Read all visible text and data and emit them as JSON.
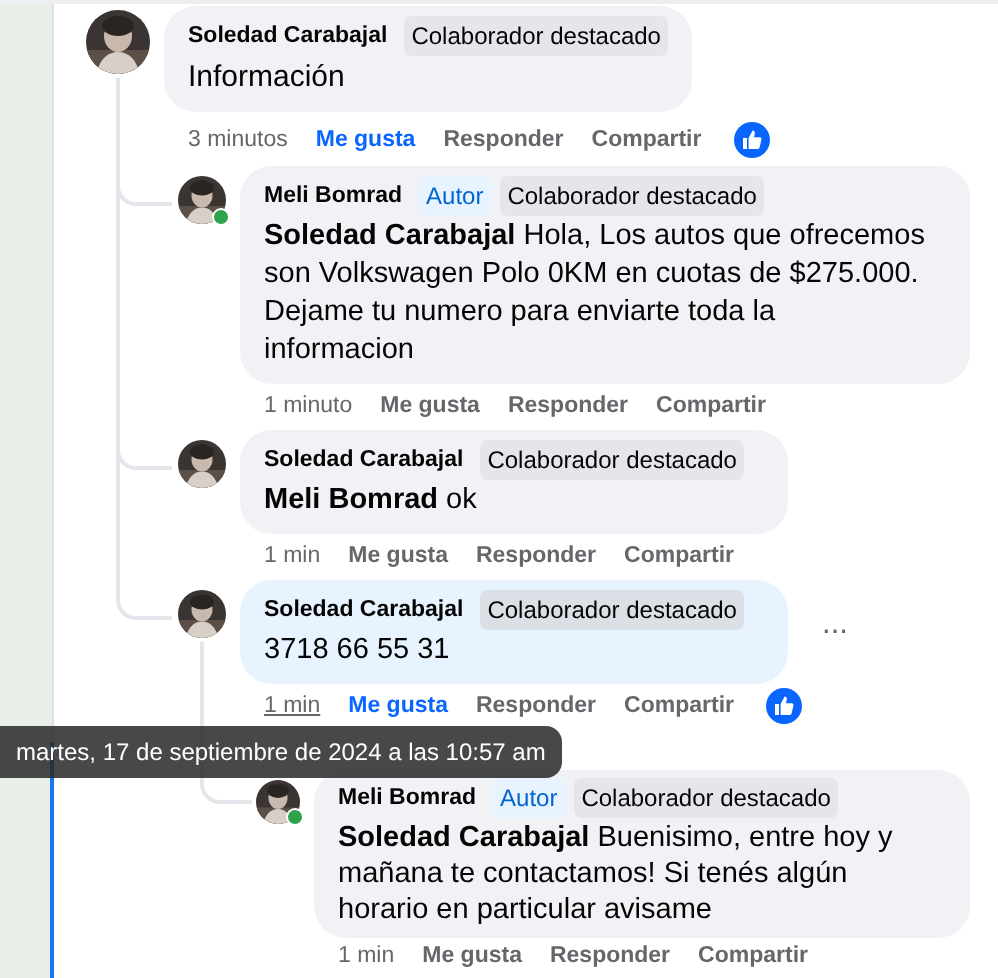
{
  "comments": [
    {
      "author": "Soledad Carabajal",
      "badges": [
        {
          "label": "Colaborador destacado",
          "kind": "contributor"
        }
      ],
      "text": "Información",
      "time": "3 minutos",
      "like_label": "Me gusta",
      "liked": true,
      "reply_label": "Responder",
      "share_label": "Compartir",
      "reaction": true,
      "children": [
        {
          "author": "Meli Bomrad",
          "badges": [
            {
              "label": "Autor",
              "kind": "author"
            },
            {
              "label": "Colaborador destacado",
              "kind": "contributor"
            }
          ],
          "text": "**Soledad Carabajal** Hola, Los autos que ofrecemos son Volkswagen Polo 0KM en cuotas de $275.000. Dejame tu numero para enviarte toda la informacion",
          "time": "1 minuto",
          "like_label": "Me gusta",
          "liked": false,
          "reply_label": "Responder",
          "share_label": "Compartir",
          "online": true
        },
        {
          "author": "Soledad Carabajal",
          "badges": [
            {
              "label": "Colaborador destacado",
              "kind": "contributor"
            }
          ],
          "text": "**Meli Bomrad** ok",
          "time": "1 min",
          "like_label": "Me gusta",
          "liked": false,
          "reply_label": "Responder",
          "share_label": "Compartir"
        },
        {
          "author": "Soledad Carabajal",
          "badges": [
            {
              "label": "Colaborador destacado",
              "kind": "contributor"
            }
          ],
          "text": "3718 66 55 31",
          "time": "1 min",
          "time_hovered": true,
          "like_label": "Me gusta",
          "liked": true,
          "reply_label": "Responder",
          "share_label": "Compartir",
          "reaction": true,
          "highlighted": true,
          "more": "···",
          "tooltip": "martes, 17 de septiembre de 2024 a las 10:57 am",
          "children": [
            {
              "author": "Meli Bomrad",
              "badges": [
                {
                  "label": "Autor",
                  "kind": "author"
                },
                {
                  "label": "Colaborador destacado",
                  "kind": "contributor"
                }
              ],
              "text": "**Soledad Carabajal** Buenisimo, entre hoy y mañana te contactamos! Si tenés algún horario en particular avisame",
              "time": "1 min",
              "like_label": "Me gusta",
              "liked": false,
              "reply_label": "Responder",
              "share_label": "Compartir",
              "online": true
            }
          ]
        }
      ]
    }
  ]
}
